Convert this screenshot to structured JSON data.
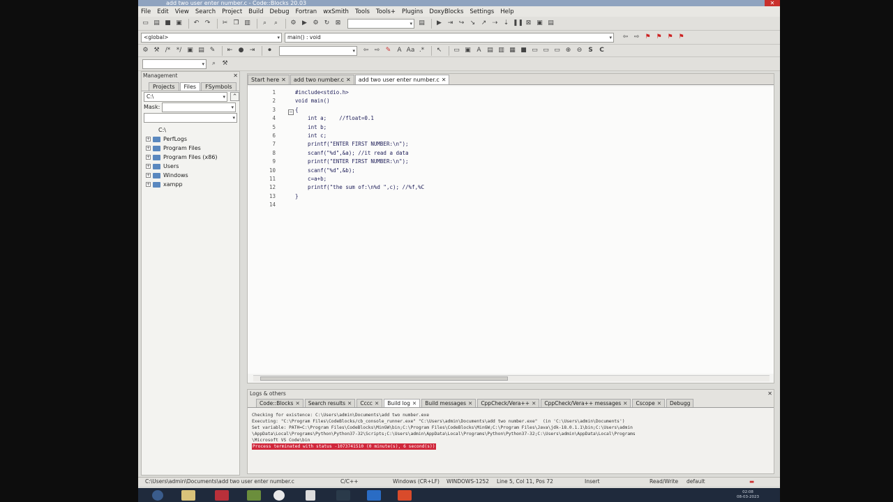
{
  "window": {
    "title": "add two user enter number.c - Code::Blocks 20.03"
  },
  "menu": [
    "File",
    "Edit",
    "View",
    "Search",
    "Project",
    "Build",
    "Debug",
    "Fortran",
    "wxSmith",
    "Tools",
    "Tools+",
    "Plugins",
    "DoxyBlocks",
    "Settings",
    "Help"
  ],
  "toolbar": {
    "scope_combo": "<global>",
    "function_combo": "main() : void"
  },
  "management": {
    "title": "Management",
    "tabs": [
      "Projects",
      "Files",
      "FSymbols"
    ],
    "path": "C:\\",
    "mask_label": "Mask:",
    "root": "C:\\",
    "tree": [
      "PerfLogs",
      "Program Files",
      "Program Files (x86)",
      "Users",
      "Windows",
      "xampp"
    ]
  },
  "editor": {
    "tabs": [
      {
        "label": "Start here"
      },
      {
        "label": "add two number.c"
      },
      {
        "label": "add two user enter number.c"
      }
    ],
    "lines": [
      {
        "n": "1",
        "text": "#include<stdio.h>"
      },
      {
        "n": "2",
        "text": "void main()"
      },
      {
        "n": "3",
        "text": "{"
      },
      {
        "n": "4",
        "text": "    int a;    //float=0.1"
      },
      {
        "n": "5",
        "text": "    int b;"
      },
      {
        "n": "6",
        "text": "    int c;"
      },
      {
        "n": "7",
        "text": "    printf(\"ENTER FIRST NUMBER:\\n\");"
      },
      {
        "n": "8",
        "text": "    scanf(\"%d\",&a); //it read a data"
      },
      {
        "n": "9",
        "text": "    printf(\"ENTER FIRST NUMBER:\\n\");"
      },
      {
        "n": "10",
        "text": "    scanf(\"%d\",&b);"
      },
      {
        "n": "11",
        "text": "    c=a+b;"
      },
      {
        "n": "12",
        "text": "    printf(\"the sum of:\\n%d \",c); //%f,%C"
      },
      {
        "n": "13",
        "text": "}"
      },
      {
        "n": "14",
        "text": ""
      }
    ]
  },
  "logs": {
    "title": "Logs & others",
    "tabs": [
      "Code::Blocks",
      "Search results",
      "Cccc",
      "Build log",
      "Build messages",
      "CppCheck/Vera++",
      "CppCheck/Vera++ messages",
      "Cscope",
      "Debugg"
    ],
    "lines": [
      "Checking for existence: C:\\Users\\admin\\Documents\\add two number.exe",
      "Executing: \"C:\\Program Files\\CodeBlocks/cb_console_runner.exe\" \"C:\\Users\\admin\\Documents\\add two number.exe\"  (in 'C:\\Users\\admin\\Documents')",
      "Set variable: PATH=C:\\Program Files\\CodeBlocks\\MinGW\\bin;C:\\Program Files\\CodeBlocks\\MinGW;C:\\Program Files\\Java\\jdk-18.0.1.1\\bin;C:\\Users\\admin",
      "\\AppData\\Local\\Programs\\Python\\Python37-32\\Scripts;C:\\Users\\admin\\AppData\\Local\\Programs\\Python\\Python37-32;C:\\Users\\admin\\AppData\\Local\\Programs",
      "\\Microsoft VS Code\\bin"
    ],
    "error": "Process terminated with status -1073741510 (0 minute(s), 6 second(s))"
  },
  "status": {
    "path": "C:\\Users\\admin\\Documents\\add two user enter number.c",
    "lang": "C/C++",
    "eol": "Windows (CR+LF)",
    "encoding": "WINDOWS-1252",
    "position": "Line 5, Col 11, Pos 72",
    "mode": "Insert",
    "access": "Read/Write",
    "profile": "default"
  },
  "taskbar": {
    "time": "02:08",
    "date": "08-03-2023"
  }
}
